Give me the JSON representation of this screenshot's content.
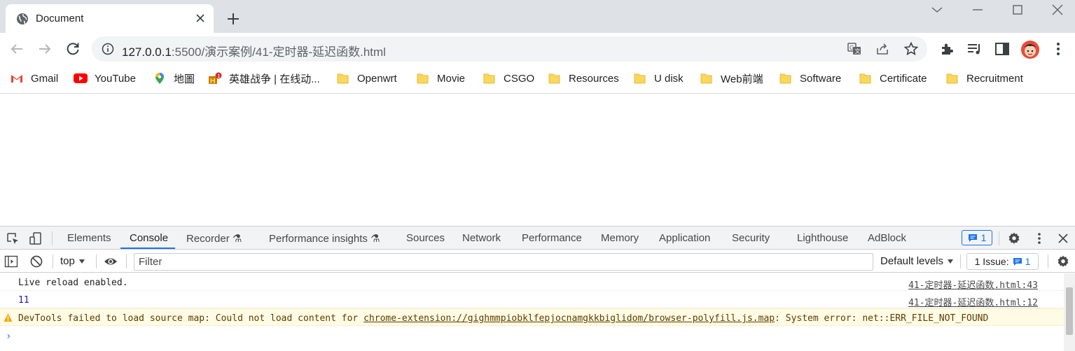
{
  "tab": {
    "title": "Document"
  },
  "omnibox": {
    "host": "127.0.0.1",
    "rest": ":5500/演示案例/41-定时器-延迟函数.html"
  },
  "bookmarks": [
    {
      "label": "Gmail",
      "icon": "gmail-icon"
    },
    {
      "label": "YouTube",
      "icon": "youtube-icon"
    },
    {
      "label": "地圖",
      "icon": "maps-icon"
    },
    {
      "label": "英雄战争 | 在线动...",
      "icon": "hero-game-icon"
    },
    {
      "label": "Openwrt",
      "icon": "folder-icon"
    },
    {
      "label": "Movie",
      "icon": "folder-icon"
    },
    {
      "label": "CSGO",
      "icon": "folder-icon"
    },
    {
      "label": "Resources",
      "icon": "folder-icon"
    },
    {
      "label": "U disk",
      "icon": "folder-icon"
    },
    {
      "label": "Web前端",
      "icon": "folder-icon"
    },
    {
      "label": "Software",
      "icon": "folder-icon"
    },
    {
      "label": "Certificate",
      "icon": "folder-icon"
    },
    {
      "label": "Recruitment",
      "icon": "folder-icon"
    }
  ],
  "devtools": {
    "tabs": [
      "Elements",
      "Console",
      "Recorder",
      "Performance insights",
      "Sources",
      "Network",
      "Performance",
      "Memory",
      "Application",
      "Security",
      "Lighthouse",
      "AdBlock"
    ],
    "active_tab": "Console",
    "issue_count": "1",
    "context": "top",
    "filter_placeholder": "Filter",
    "levels": "Default levels",
    "issues_label": "1 Issue:",
    "issues_count": "1",
    "messages": [
      {
        "text": "Live reload enabled.",
        "source": "41-定时器-延迟函数.html:43"
      },
      {
        "text": "11",
        "source": "41-定时器-延迟函数.html:12"
      }
    ],
    "warning": {
      "prefix": "DevTools failed to load source map: Could not load content for ",
      "link": "chrome-extension://gighmmpiobklfepjocnamgkkbiglidom/browser-polyfill.js.map",
      "suffix": ": System error: net::ERR_FILE_NOT_FOUND"
    },
    "prompt": "›"
  },
  "colors": {
    "accent": "#1a73e8",
    "warning_bg": "#fffbe5",
    "tabstrip": "#dee1e6"
  }
}
